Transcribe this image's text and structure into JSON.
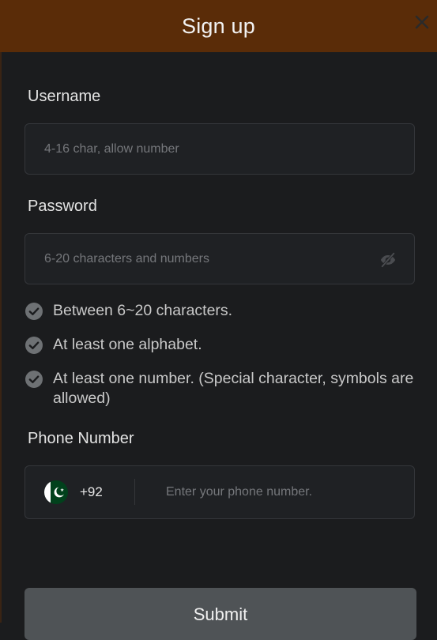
{
  "header": {
    "title": "Sign up",
    "close_icon": "close-icon"
  },
  "username": {
    "label": "Username",
    "placeholder": "4-16 char, allow number",
    "value": ""
  },
  "password": {
    "label": "Password",
    "placeholder": "6-20 characters and numbers",
    "value": "",
    "toggle_icon": "eye-slash-icon"
  },
  "password_rules": [
    {
      "text": "Between 6~20 characters.",
      "icon": "check-circle-icon"
    },
    {
      "text": "At least one alphabet.",
      "icon": "check-circle-icon"
    },
    {
      "text": "At least one number. (Special character, symbols are allowed)",
      "icon": "check-circle-icon"
    }
  ],
  "phone": {
    "label": "Phone Number",
    "country_flag": "pakistan-flag-icon",
    "dial_code": "+92",
    "placeholder": "Enter your phone number.",
    "value": ""
  },
  "submit": {
    "label": "Submit"
  },
  "colors": {
    "header_bg": "#5a2c08",
    "page_bg": "#1b1c1e",
    "field_bg": "#1f2124",
    "field_border": "#34363a",
    "check_icon": "#6e7174",
    "submit_bg": "#4f5356"
  }
}
